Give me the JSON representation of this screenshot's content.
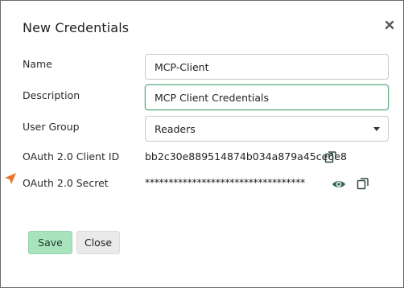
{
  "dialog": {
    "title": "New Credentials",
    "close_icon": "close-icon"
  },
  "form": {
    "name_label": "Name",
    "name_value": "MCP-Client",
    "description_label": "Description",
    "description_value": "MCP Client Credentials",
    "user_group_label": "User Group",
    "user_group_value": "Readers",
    "client_id_label": "OAuth 2.0 Client ID",
    "client_id_value": "bb2c30e889514874b034a879a45ce6e8",
    "secret_label": "OAuth 2.0 Secret",
    "secret_value": "**********************************"
  },
  "icons": {
    "copy": "copy-icon",
    "eye": "eye-icon",
    "pointer": "pointer-marker-icon"
  },
  "buttons": {
    "save_label": "Save",
    "close_label": "Close"
  },
  "colors": {
    "accent_green": "#5cab80",
    "save_bg": "#a8e3bd",
    "icon_green": "#2f6b4f",
    "marker_orange": "#e8752e"
  }
}
